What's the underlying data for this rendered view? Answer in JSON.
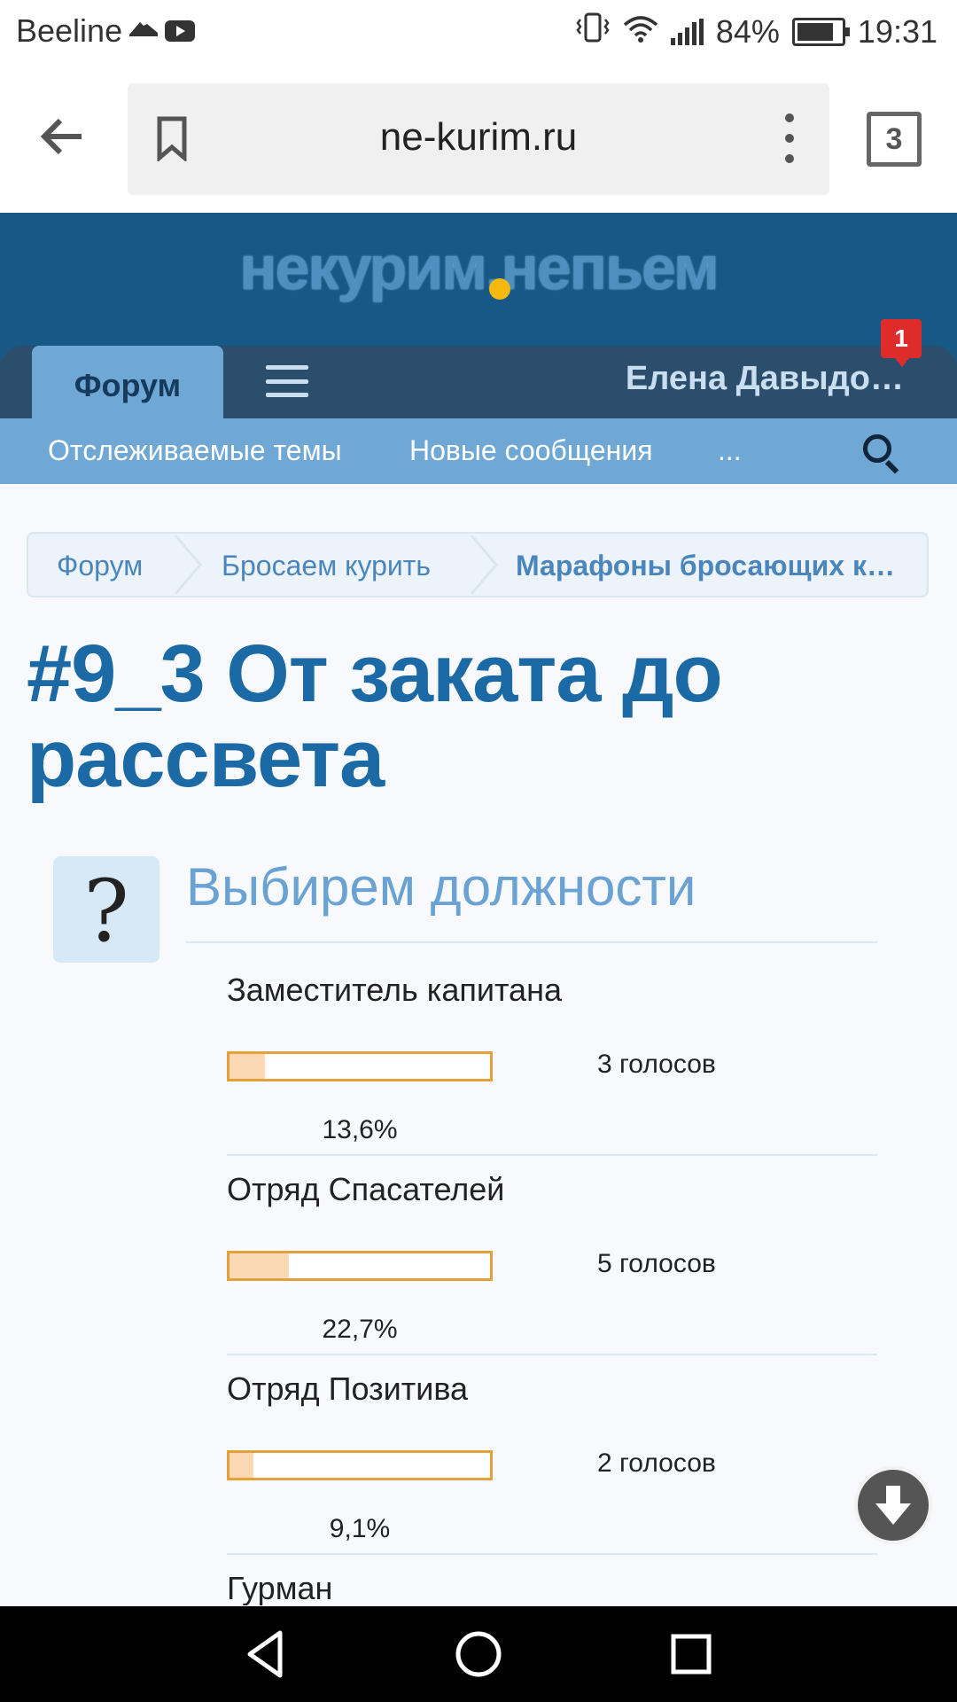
{
  "status_bar": {
    "carrier": "Beeline",
    "battery": "84%",
    "time": "19:31"
  },
  "browser": {
    "url": "ne-kurim.ru",
    "tab_count": "3"
  },
  "site": {
    "logo_text": "некурим.непьем",
    "nav": {
      "forum_tab": "Форум",
      "username": "Елена Давыдо…",
      "notification_count": "1"
    },
    "subnav": {
      "watched": "Отслеживаемые темы",
      "new_posts": "Новые сообщения",
      "more": "..."
    }
  },
  "breadcrumb": [
    "Форум",
    "Бросаем курить",
    "Марафоны бросающих к…"
  ],
  "page_title": "#9_3 От заката до рассвета",
  "poll": {
    "question_icon": "?",
    "question": "Выбирем должности",
    "options": [
      {
        "label": "Заместитель капитана",
        "votes": "3 голосов",
        "percent": "13,6%",
        "fraction": 0.136
      },
      {
        "label": "Отряд Спасателей",
        "votes": "5 голосов",
        "percent": "22,7%",
        "fraction": 0.227
      },
      {
        "label": "Отряд Позитива",
        "votes": "2 голосов",
        "percent": "9,1%",
        "fraction": 0.091
      },
      {
        "label": "Гурман",
        "votes": "",
        "percent": "",
        "fraction": null
      }
    ]
  },
  "colors": {
    "header_bg": "#185886",
    "nav_bg": "#2b4e6d",
    "accent_light": "#6fa8d4",
    "title": "#1b6aa5",
    "bar_border": "#e3a13e",
    "bar_fill": "#fbd9b4"
  },
  "icons": {
    "status_left": [
      "shoe-icon",
      "youtube-icon"
    ],
    "status_right": [
      "vibrate-icon",
      "wifi-icon",
      "signal-icon",
      "battery-icon"
    ],
    "browser": [
      "back-arrow-icon",
      "bookmark-icon",
      "more-vert-icon",
      "tabs-icon"
    ],
    "fab": "arrow-down-icon",
    "system_nav": [
      "back-triangle-icon",
      "home-circle-icon",
      "recents-square-icon"
    ]
  }
}
